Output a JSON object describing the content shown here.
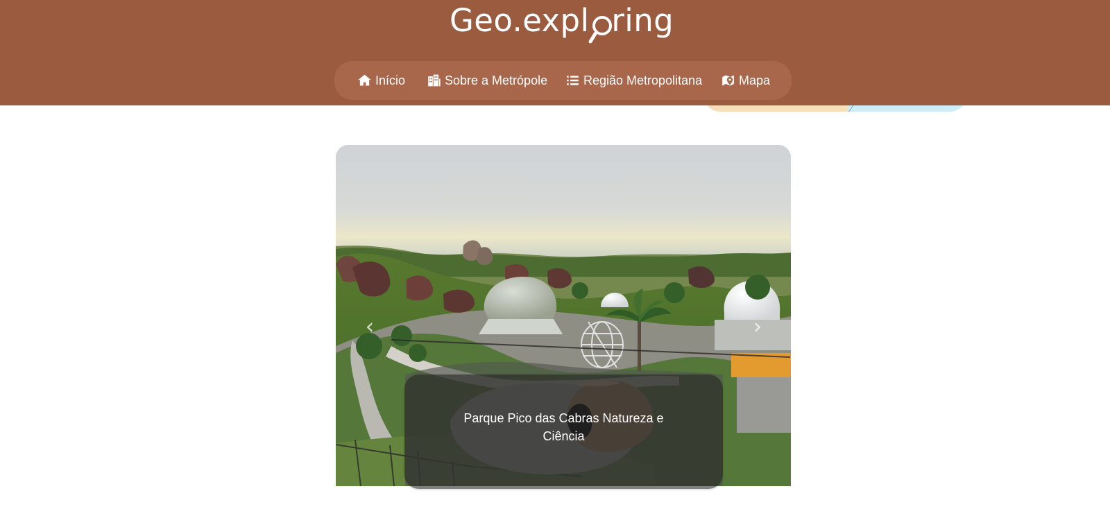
{
  "header": {
    "logo": {
      "prefix": "Geo.expl",
      "suffix": "ring",
      "lens_icon": "magnifying-glass-icon",
      "full_text": "Geo.exploring"
    },
    "background_color": "#9a5b3f"
  },
  "nav": {
    "background_color": "#a8664b",
    "items": [
      {
        "label": "Início",
        "icon": "home-icon"
      },
      {
        "label": "Sobre a Metrópole",
        "icon": "buildings-icon"
      },
      {
        "label": "Região Metropolitana",
        "icon": "list-icon"
      },
      {
        "label": "Mapa",
        "icon": "map-pin-icon"
      }
    ]
  },
  "carousel": {
    "caption": "Parque Pico das Cabras Natureza e Ciência",
    "previous_icon": "chevron-left-icon",
    "next_icon": "chevron-right-icon",
    "image_subject": "park-landscape-photo"
  },
  "colors": {
    "text_light": "#ffffff",
    "decorative_peach": "#f7dfb9",
    "decorative_sky": "#cdeef8"
  }
}
